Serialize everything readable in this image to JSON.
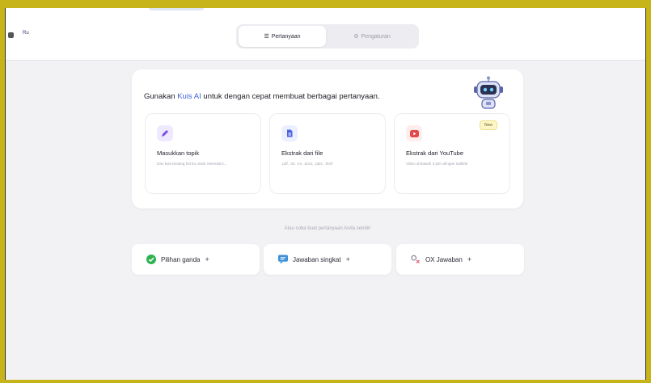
{
  "topbar": {
    "left_label": "Ru"
  },
  "tabs": [
    {
      "label": "Pertanyaan",
      "icon": "list-icon",
      "active": true
    },
    {
      "label": "Pengaturan",
      "icon": "settings-icon",
      "active": false
    }
  ],
  "ai_panel": {
    "headline_prefix": "Gunakan",
    "headline_accent": "Kuis AI",
    "headline_suffix": "untuk dengan cepat membuat berbagai pertanyaan.",
    "accent_color": "#3f63d6",
    "options": [
      {
        "title": "Masukkan topik",
        "desc": "Dan kuis tentang hal itu untuk memulai k...",
        "icon": "pencil-icon",
        "color": "#7b4ce6"
      },
      {
        "title": "Ekstrak dari file",
        "desc": ".pdf, .txt, .ini, .docx, .pptx, .html",
        "icon": "file-icon",
        "color": "#4d63e0"
      },
      {
        "title": "Ekstrak dari YouTube",
        "desc": "Video di bawah 3 jam dengan subtitle",
        "icon": "youtube-icon",
        "color": "#e24a4a",
        "badge": "New"
      }
    ]
  },
  "manual": {
    "divider": "Atau coba buat pertanyaan Anda sendiri",
    "buttons": [
      {
        "label": "Pilihan ganda",
        "icon": "checkmark-circle-icon",
        "color": "#2fb34f"
      },
      {
        "label": "Jawaban singkat",
        "icon": "chat-bubble-icon",
        "color": "#3d8fd8"
      },
      {
        "label": "OX Jawaban",
        "icon": "ox-icon",
        "color": "#8a8a99"
      }
    ],
    "plus": "+"
  }
}
